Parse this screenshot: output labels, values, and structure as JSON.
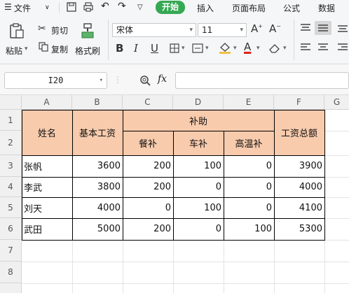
{
  "menubar": {
    "file_label": "文件",
    "tabs": [
      "开始",
      "插入",
      "页面布局",
      "公式",
      "数据"
    ],
    "active_tab": "开始",
    "active_color": "#35a853"
  },
  "ribbon": {
    "paste_label": "粘贴",
    "cut_label": "剪切",
    "copy_label": "复制",
    "format_painter_label": "格式刷",
    "font_name": "宋体",
    "font_size": "11"
  },
  "formula_bar": {
    "cell_ref": "I20",
    "fx_label": "fx",
    "formula_value": ""
  },
  "sheet": {
    "columns": [
      "A",
      "B",
      "C",
      "D",
      "E",
      "F",
      "G"
    ],
    "rows": [
      "1",
      "2",
      "3",
      "4",
      "5",
      "6",
      "7",
      "8"
    ],
    "header_fill": "#f8cbad",
    "headers": {
      "name": "姓名",
      "base_salary": "基本工资",
      "subsidy": "补助",
      "meal": "餐补",
      "car": "车补",
      "heat": "高温补",
      "total": "工资总额"
    },
    "data_rows": [
      {
        "name": "张帆",
        "base": "3600",
        "meal": "200",
        "car": "100",
        "heat": "0",
        "total": "3900"
      },
      {
        "name": "李武",
        "base": "3800",
        "meal": "200",
        "car": "0",
        "heat": "0",
        "total": "4000"
      },
      {
        "name": "刘天",
        "base": "4000",
        "meal": "0",
        "car": "100",
        "heat": "0",
        "total": "4100"
      },
      {
        "name": "武田",
        "base": "5000",
        "meal": "200",
        "car": "0",
        "heat": "100",
        "total": "5300"
      }
    ]
  }
}
